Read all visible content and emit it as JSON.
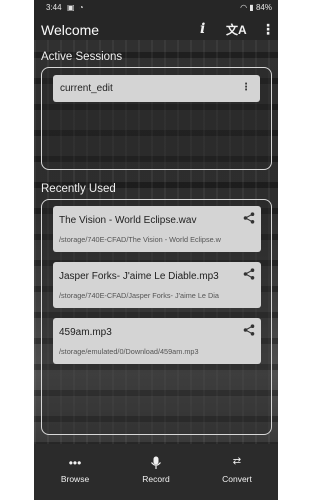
{
  "status_bar": {
    "time": "3:44",
    "battery": "84%"
  },
  "app_bar": {
    "title": "Welcome",
    "icons": [
      "info-icon",
      "translate-icon",
      "more-vert-icon"
    ]
  },
  "active_sessions": {
    "heading": "Active Sessions",
    "items": [
      {
        "label": "current_edit"
      }
    ]
  },
  "recently_used": {
    "heading": "Recently Used",
    "items": [
      {
        "name": "The Vision - World Eclipse.wav",
        "path": "/storage/740E-CFAD/The Vision - World Eclipse.w"
      },
      {
        "name": "Jasper Forks- J'aime Le Diable.mp3",
        "path": "/storage/740E-CFAD/Jasper Forks- J'aime Le Dia"
      },
      {
        "name": "459am.mp3",
        "path": "/storage/emulated/0/Download/459am.mp3"
      }
    ]
  },
  "bottom_nav": {
    "items": [
      {
        "label": "Browse",
        "icon": "more-horiz-icon"
      },
      {
        "label": "Record",
        "icon": "microphone-icon"
      },
      {
        "label": "Convert",
        "icon": "swap-arrows-icon"
      }
    ]
  }
}
